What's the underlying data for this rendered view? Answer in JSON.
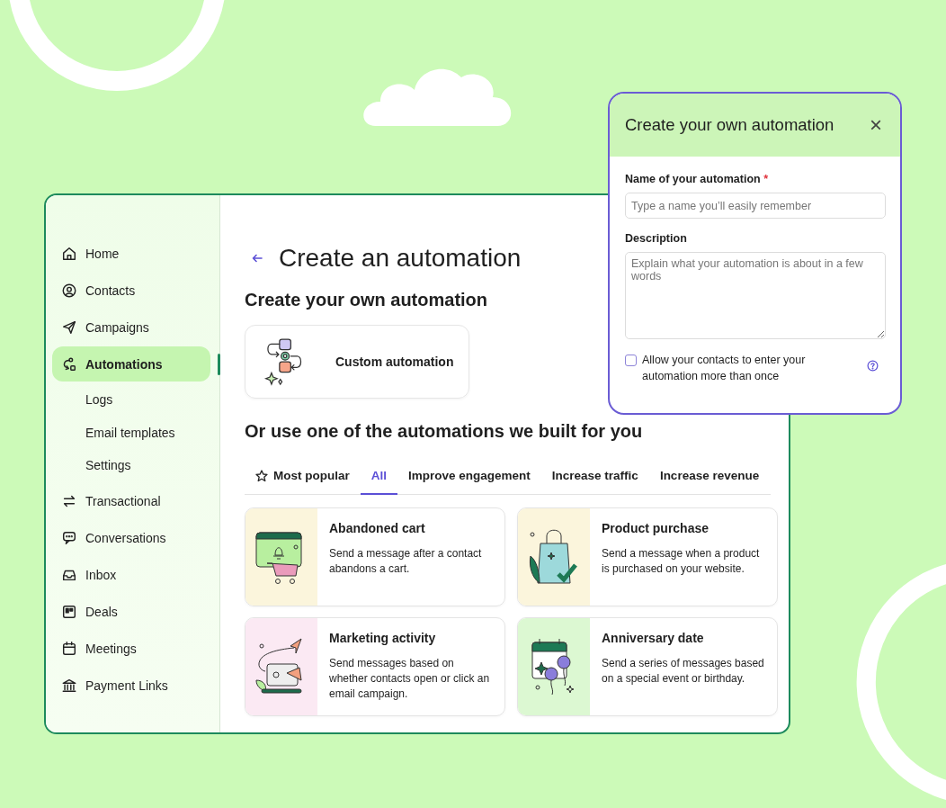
{
  "sidebar": {
    "items": [
      {
        "label": "Home",
        "kind": "home",
        "selected": false
      },
      {
        "label": "Contacts",
        "kind": "contact",
        "selected": false
      },
      {
        "label": "Campaigns",
        "kind": "send",
        "selected": false
      },
      {
        "label": "Automations",
        "kind": "automation",
        "selected": true,
        "children": [
          {
            "label": "Logs"
          },
          {
            "label": "Email templates"
          },
          {
            "label": "Settings"
          }
        ]
      },
      {
        "label": "Transactional",
        "kind": "swap",
        "selected": false
      },
      {
        "label": "Conversations",
        "kind": "chat",
        "selected": false
      },
      {
        "label": "Inbox",
        "kind": "inbox",
        "selected": false
      },
      {
        "label": "Deals",
        "kind": "board",
        "selected": false
      },
      {
        "label": "Meetings",
        "kind": "calendar",
        "selected": false
      },
      {
        "label": "Payment Links",
        "kind": "bank",
        "selected": false
      }
    ]
  },
  "page": {
    "title": "Create an automation",
    "own_heading": "Create your own automation",
    "custom_card": "Custom automation",
    "builtin_heading": "Or use one of the automations we built for you"
  },
  "tabs": [
    {
      "label": "Most popular",
      "kind": "starred",
      "selected": false
    },
    {
      "label": "All",
      "selected": true
    },
    {
      "label": "Improve engagement",
      "selected": false
    },
    {
      "label": "Increase traffic",
      "selected": false
    },
    {
      "label": "Increase revenue",
      "selected": false
    }
  ],
  "templates": [
    {
      "title": "Abandoned cart",
      "description": "Send a message after a contact abandons a cart.",
      "kind": "cart",
      "color": "#fbf5dc"
    },
    {
      "title": "Product purchase",
      "description": "Send a message when a product is purchased on your website.",
      "kind": "bag",
      "color": "#fbf5dc"
    },
    {
      "title": "Marketing activity",
      "description": "Send messages based on whether contacts open or click an email campaign.",
      "kind": "megaphone",
      "color": "#fbe9f3"
    },
    {
      "title": "Anniversary date",
      "description": "Send a series of messages based on a special event or birthday.",
      "kind": "calendar",
      "color": "#dcf8d2"
    }
  ],
  "dialog": {
    "title": "Create your own automation",
    "close": "×",
    "name_label": "Name of your automation",
    "required_mark": "*",
    "name_placeholder": "Type a name you’ll easily remember",
    "description_label": "Description",
    "description_placeholder": "Explain what your automation is about in a few words",
    "checkbox_label": "Allow your contacts to enter your automation more than once",
    "checked": false
  }
}
